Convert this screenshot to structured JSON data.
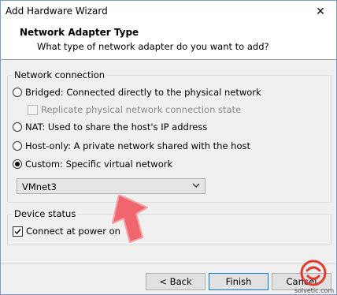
{
  "window": {
    "title": "Add Hardware Wizard",
    "close_symbol": "✕"
  },
  "header": {
    "title": "Network Adapter Type",
    "subtitle": "What type of network adapter do you want to add?"
  },
  "network_connection": {
    "group_label": "Network connection",
    "options": [
      {
        "label": "Bridged: Connected directly to the physical network",
        "selected": false
      },
      {
        "label": "NAT: Used to share the host's IP address",
        "selected": false
      },
      {
        "label": "Host-only: A private network shared with the host",
        "selected": false
      },
      {
        "label": "Custom: Specific virtual network",
        "selected": true
      }
    ],
    "replicate_label": "Replicate physical network connection state",
    "replicate_checked": false,
    "replicate_enabled": false,
    "custom_network": {
      "selected": "VMnet3"
    }
  },
  "device_status": {
    "group_label": "Device status",
    "connect_label": "Connect at power on",
    "connect_checked": true
  },
  "buttons": {
    "back": "< Back",
    "finish": "Finish",
    "cancel": "Cancel"
  },
  "watermark": {
    "text": "solvetic.com"
  },
  "colors": {
    "annotation_arrow": "#f0666e",
    "watermark": "#e03a2d",
    "focus_border": "#0078d7"
  }
}
